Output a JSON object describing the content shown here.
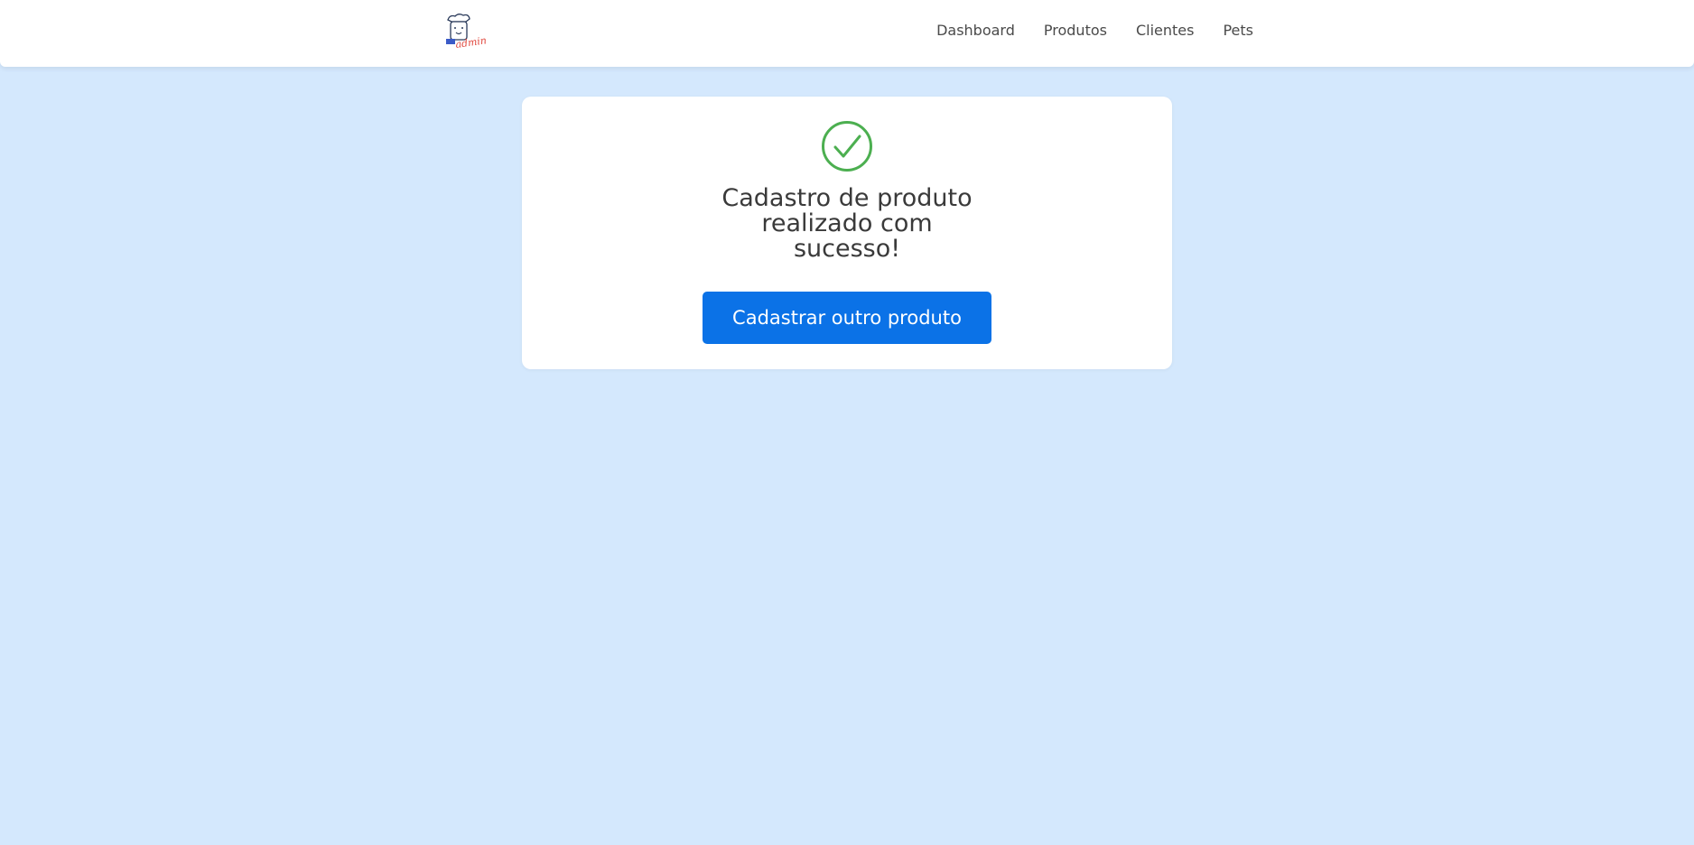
{
  "header": {
    "logo_icon": "dog-chef-admin-logo",
    "logo_text": "admin",
    "nav": [
      {
        "label": "Dashboard"
      },
      {
        "label": "Produtos"
      },
      {
        "label": "Clientes"
      },
      {
        "label": "Pets"
      }
    ]
  },
  "success_card": {
    "icon": "check-circle-icon",
    "icon_color": "#4caf50",
    "message_line1": "Cadastro de produto",
    "message_line2": "realizado com",
    "message_line3": "sucesso!",
    "button_label": "Cadastrar outro produto",
    "button_color": "#0b72e7"
  },
  "colors": {
    "background": "#d4e8fd",
    "accent": "#0b72e7"
  }
}
